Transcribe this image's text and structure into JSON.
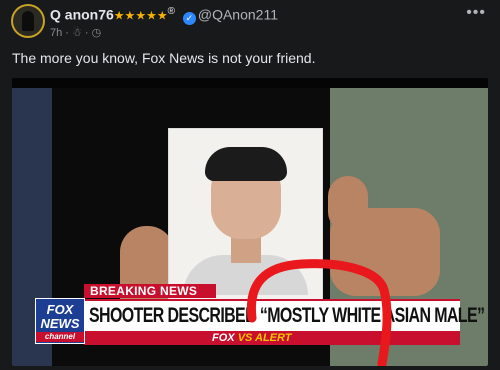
{
  "post": {
    "author_name": "Q anon76",
    "author_stars": "★★★★★",
    "author_reg": "®",
    "verified_glyph": "✓",
    "handle": "@QAnon211",
    "meta": "7h · ☃ · ◷",
    "more": "•••",
    "caption": "The more you know, Fox News is not your friend."
  },
  "media": {
    "logo": {
      "line1": "FOX",
      "line2": "NEWS",
      "line3": "channel"
    },
    "breaking": "BREAKING NEWS",
    "headline": "SHOOTER DESCRIBED “MOSTLY WHITE ASIAN MALE”",
    "alert_prefix": "FOX",
    "alert_suffix": "VS ALERT",
    "colors": {
      "fox_red": "#c8102e",
      "fox_blue": "#1c3f94",
      "scribble": "#e8181c"
    }
  }
}
